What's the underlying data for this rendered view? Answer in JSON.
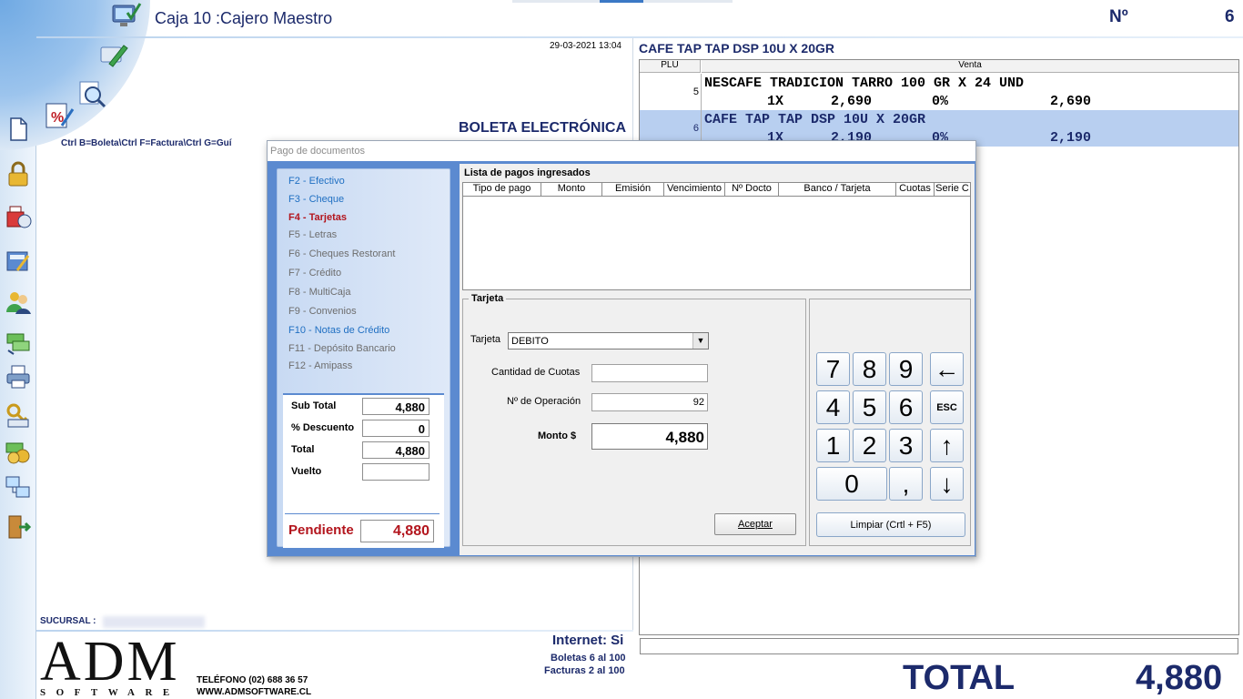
{
  "header": {
    "caja_title": "Caja 10 :Cajero Maestro",
    "numero_label": "Nº",
    "numero_value": "6"
  },
  "document": {
    "datetime": "29-03-2021 13:04",
    "boleta_title": "BOLETA ELECTRÓNICA",
    "shortcut_hint": "Ctrl B=Boleta\\Ctrl F=Factura\\Ctrl G=Guí",
    "sucursal_label": "SUCURSAL :"
  },
  "footer": {
    "logo": "ADM",
    "logo_sub": "SOFTWARE",
    "telefono": "TELÉFONO (02) 688 36 57",
    "web": "WWW.ADMSOFTWARE.CL",
    "internet": "Internet: Si",
    "boletas": "Boletas 6 al 100",
    "facturas": "Facturas 2 al 100"
  },
  "sales": {
    "product_title": "CAFE TAP TAP DSP 10U X 20GR",
    "col_plu": "PLU",
    "col_venta": "Venta",
    "rows": [
      {
        "plu": "5",
        "desc": "NESCAFE TRADICION TARRO 100 GR X 24 UND",
        "qty": "1X",
        "price": "2,690",
        "disc": "0%",
        "amount": "2,690",
        "selected": false
      },
      {
        "plu": "6",
        "desc": "CAFE TAP TAP DSP 10U X 20GR",
        "qty": "1X",
        "price": "2,190",
        "disc": "0%",
        "amount": "2,190",
        "selected": true
      }
    ],
    "total_label": "TOTAL",
    "total_value": "4,880"
  },
  "dialog": {
    "title": "Pago de documentos",
    "payment_options": [
      {
        "label": "F2 - Efectivo",
        "state": "enabled"
      },
      {
        "label": "F3 - Cheque",
        "state": "enabled"
      },
      {
        "label": "F4 - Tarjetas",
        "state": "active"
      },
      {
        "label": "F5 - Letras",
        "state": "disabled"
      },
      {
        "label": "F6 - Cheques Restorant",
        "state": "disabled"
      },
      {
        "label": "F7 - Crédito",
        "state": "disabled"
      },
      {
        "label": "F8 - MultiCaja",
        "state": "disabled"
      },
      {
        "label": "F9 - Convenios",
        "state": "disabled"
      },
      {
        "label": "F10 - Notas de Crédito",
        "state": "enabled"
      },
      {
        "label": "F11 - Depósito Bancario",
        "state": "disabled"
      },
      {
        "label": "F12 - Amipass",
        "state": "disabled"
      }
    ],
    "totals": {
      "sub_total_label": "Sub Total",
      "sub_total": "4,880",
      "descuento_label": "% Descuento",
      "descuento": "0",
      "total_label": "Total",
      "total": "4,880",
      "vuelto_label": "Vuelto",
      "vuelto": "",
      "pendiente_label": "Pendiente",
      "pendiente": "4,880"
    },
    "payments_list": {
      "title": "Lista de pagos ingresados",
      "columns": [
        "Tipo de pago",
        "Monto",
        "Emisión",
        "Vencimiento",
        "Nº Docto",
        "Banco / Tarjeta",
        "Cuotas",
        "Serie C"
      ],
      "rows": []
    },
    "tarjeta": {
      "legend": "Tarjeta",
      "tarjeta_label": "Tarjeta",
      "tarjeta_value": "DEBITO",
      "cuotas_label": "Cantidad de Cuotas",
      "cuotas_value": "",
      "operacion_label": "Nº de Operación",
      "operacion_value": "92",
      "monto_label": "Monto $",
      "monto_value": "4,880",
      "aceptar": "Aceptar"
    },
    "keypad": {
      "keys": [
        "7",
        "8",
        "9",
        "←",
        "4",
        "5",
        "6",
        "ESC",
        "1",
        "2",
        "3",
        "↑",
        "0",
        ",",
        "↓"
      ],
      "limpiar": "Limpiar (Crtl + F5)"
    }
  },
  "colors": {
    "brand_navy": "#1c2a6b",
    "selected_row": "#b8cff0",
    "pending_red": "#b3151d",
    "dialog_blue": "#5b8ad0"
  }
}
